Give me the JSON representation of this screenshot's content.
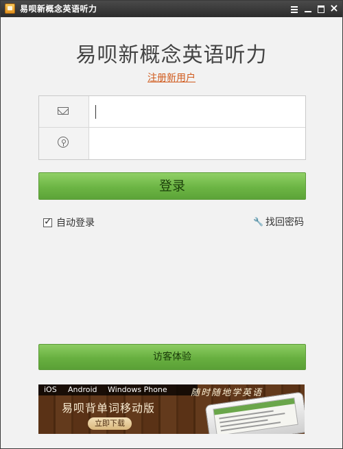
{
  "window": {
    "title": "易呗新概念英语听力",
    "controls": [
      "menu-icon",
      "minimize-icon",
      "maximize-icon",
      "close-icon"
    ]
  },
  "login": {
    "app_title": "易呗新概念英语听力",
    "register_link": "注册新用户",
    "email_field": {
      "value": "",
      "placeholder": "",
      "icon": "mail-icon"
    },
    "password_field": {
      "value": "",
      "placeholder": "",
      "icon": "key-icon"
    },
    "login_button": "登录",
    "auto_login": {
      "label": "自动登录",
      "checked": true
    },
    "forgot_password": {
      "label": "找回密码",
      "icon": "wrench-icon"
    },
    "guest_button": "访客体验"
  },
  "banner": {
    "platforms": [
      "iOS",
      "Android",
      "Windows Phone"
    ],
    "slogan": "随时随地学英语",
    "headline": "易呗背单词移动版",
    "download_button": "立即下载"
  },
  "colors": {
    "title_bar": "#333333",
    "accent_green": "#6cb544",
    "link_orange": "#d05a1c",
    "background": "#f2f2f2"
  }
}
